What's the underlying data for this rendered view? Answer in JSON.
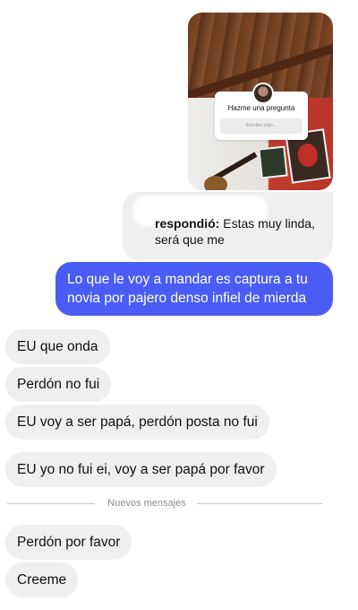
{
  "story": {
    "question_title": "Hazme una pregunta",
    "question_placeholder": "Escribe algo..."
  },
  "reply": {
    "bold": "respondió:",
    "text": " Estas muy linda, será que me"
  },
  "messages": [
    {
      "from": "me",
      "text": "Lo que le voy a mandar es captura a tu novia por pajero denso infiel de mierda"
    },
    {
      "from": "them",
      "text": "EU que onda"
    },
    {
      "from": "them",
      "text": "Perdón no fui"
    },
    {
      "from": "them",
      "text": "EU voy a ser papá, perdón posta no fui"
    },
    {
      "from": "them",
      "text": "EU yo no fui ei, voy a ser papá por favor"
    },
    {
      "from": "them",
      "text": "Perdón por favor"
    },
    {
      "from": "them",
      "text": "Creeme"
    }
  ],
  "divider_label": "Nuevos mensajes",
  "colors": {
    "outgoing_bubble": "#4a5cf3",
    "incoming_bubble": "#efefef"
  }
}
